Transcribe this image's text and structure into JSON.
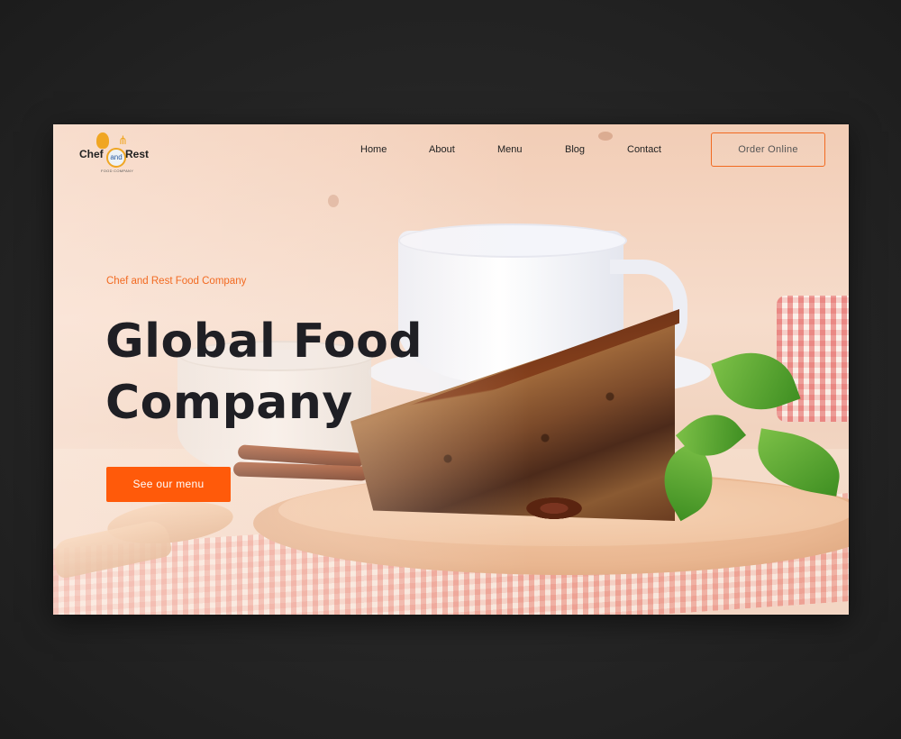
{
  "brand": {
    "left_word": "Chef",
    "middle_word": "and",
    "right_word": "Rest",
    "tagline": "FOOD COMPANY"
  },
  "nav": {
    "items": [
      "Home",
      "About",
      "Menu",
      "Blog",
      "Contact"
    ]
  },
  "header": {
    "order_label": "Order Online"
  },
  "hero": {
    "subtitle": "Chef and Rest Food Company",
    "title_line1": "Global Food",
    "title_line2": "Company",
    "cta_label": "See our menu"
  },
  "colors": {
    "accent": "#ff5a0a",
    "text_dark": "#1f1f24",
    "backdrop": "#222222"
  }
}
